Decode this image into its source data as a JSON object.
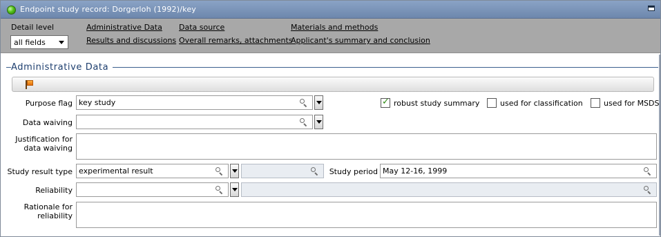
{
  "window": {
    "title": "Endpoint study record: Dorgerloh (1992)/key"
  },
  "toolbar": {
    "detail_level_label": "Detail level",
    "detail_level_value": "all fields",
    "links": [
      "Administrative Data",
      "Data source",
      "Materials and methods",
      "Results and discussions",
      "Overall remarks, attachments",
      "Applicant's summary and conclusion"
    ]
  },
  "section": {
    "title": "Administrative Data"
  },
  "form": {
    "purpose_flag_label": "Purpose flag",
    "purpose_flag_value": "key study",
    "data_waiving_label": "Data waiving",
    "data_waiving_value": "",
    "justification_label_1": "Justification for",
    "justification_label_2": "data waiving",
    "study_result_type_label": "Study result type",
    "study_result_type_value": "experimental result",
    "study_period_label": "Study period",
    "study_period_value": "May 12-16, 1999",
    "reliability_label": "Reliability",
    "reliability_value": "",
    "rationale_label_1": "Rationale for",
    "rationale_label_2": "reliability"
  },
  "checkboxes": [
    {
      "label": "robust study summary",
      "checked": true
    },
    {
      "label": "used for classification",
      "checked": false
    },
    {
      "label": "used for MSDS",
      "checked": false
    }
  ],
  "icons": {
    "status": "green-circle-icon",
    "flag": "flag-icon",
    "search": "magnifier-icon",
    "dropdown": "chevron-down-icon"
  }
}
